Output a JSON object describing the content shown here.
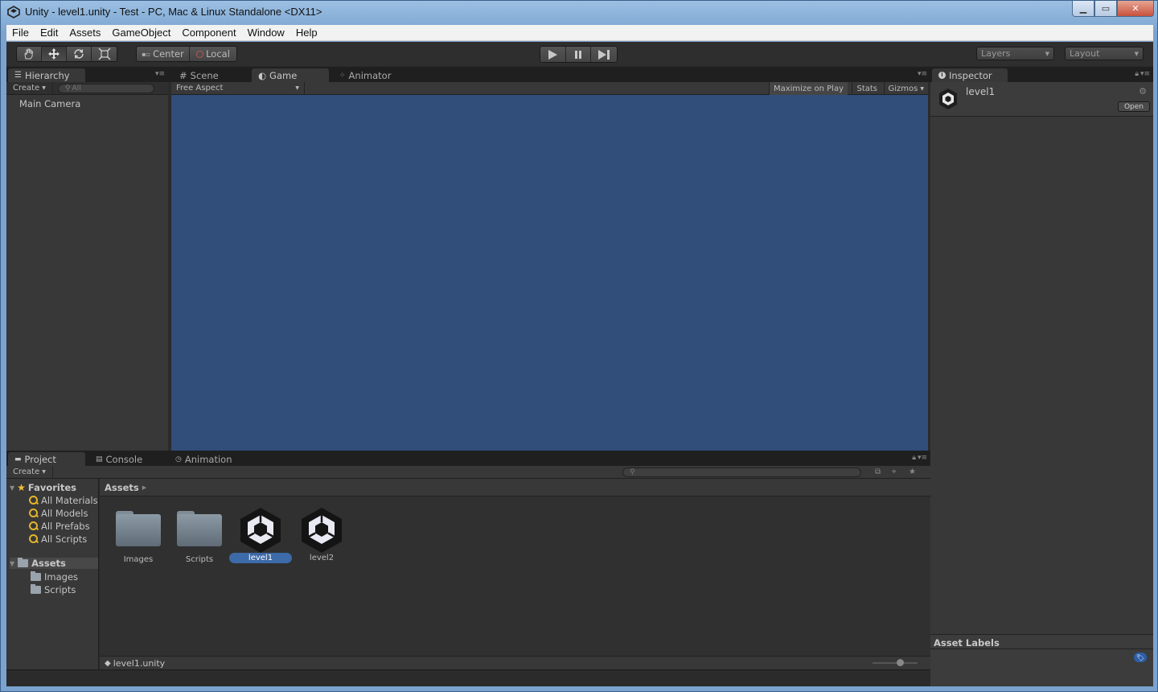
{
  "window": {
    "title": "Unity - level1.unity - Test - PC, Mac & Linux Standalone <DX11>",
    "controls": [
      "minimize",
      "maximize",
      "close"
    ]
  },
  "menu": [
    "File",
    "Edit",
    "Assets",
    "GameObject",
    "Component",
    "Window",
    "Help"
  ],
  "toolbar": {
    "tools": [
      "hand-tool",
      "move-tool",
      "rotate-tool",
      "scale-tool"
    ],
    "active_tool": "move-tool",
    "pivot_label": "Center",
    "space_label": "Local",
    "playback": [
      "play",
      "pause",
      "step"
    ],
    "layers_label": "Layers",
    "layout_label": "Layout"
  },
  "hierarchy": {
    "tab_label": "Hierarchy",
    "create_label": "Create",
    "search_placeholder": "All",
    "items": [
      "Main Camera"
    ]
  },
  "center": {
    "tabs": [
      {
        "label": "Scene",
        "icon": "scene-grid-icon"
      },
      {
        "label": "Game",
        "icon": "game-icon"
      },
      {
        "label": "Animator",
        "icon": "animator-icon"
      }
    ],
    "selected_tab": "Game",
    "aspect_label": "Free Aspect",
    "maximize_label": "Maximize on Play",
    "stats_label": "Stats",
    "gizmos_label": "Gizmos",
    "background_color": "#314d79"
  },
  "inspector": {
    "tab_label": "Inspector",
    "asset_name": "level1",
    "open_label": "Open",
    "asset_labels_title": "Asset Labels"
  },
  "bottom": {
    "tabs": [
      {
        "label": "Project",
        "icon": "project-icon"
      },
      {
        "label": "Console",
        "icon": "console-icon"
      },
      {
        "label": "Animation",
        "icon": "animation-icon"
      }
    ],
    "create_label": "Create",
    "favorites_label": "Favorites",
    "favorites": [
      "All Materials",
      "All Models",
      "All Prefabs",
      "All Scripts"
    ],
    "assets_root_label": "Assets",
    "asset_folders": [
      "Images",
      "Scripts"
    ],
    "breadcrumb": "Assets",
    "grid_items": [
      {
        "name": "Images",
        "kind": "folder"
      },
      {
        "name": "Scripts",
        "kind": "folder"
      },
      {
        "name": "level1",
        "kind": "scene"
      },
      {
        "name": "level2",
        "kind": "scene"
      }
    ],
    "selected_item": "level1",
    "status_path": "level1.unity"
  }
}
